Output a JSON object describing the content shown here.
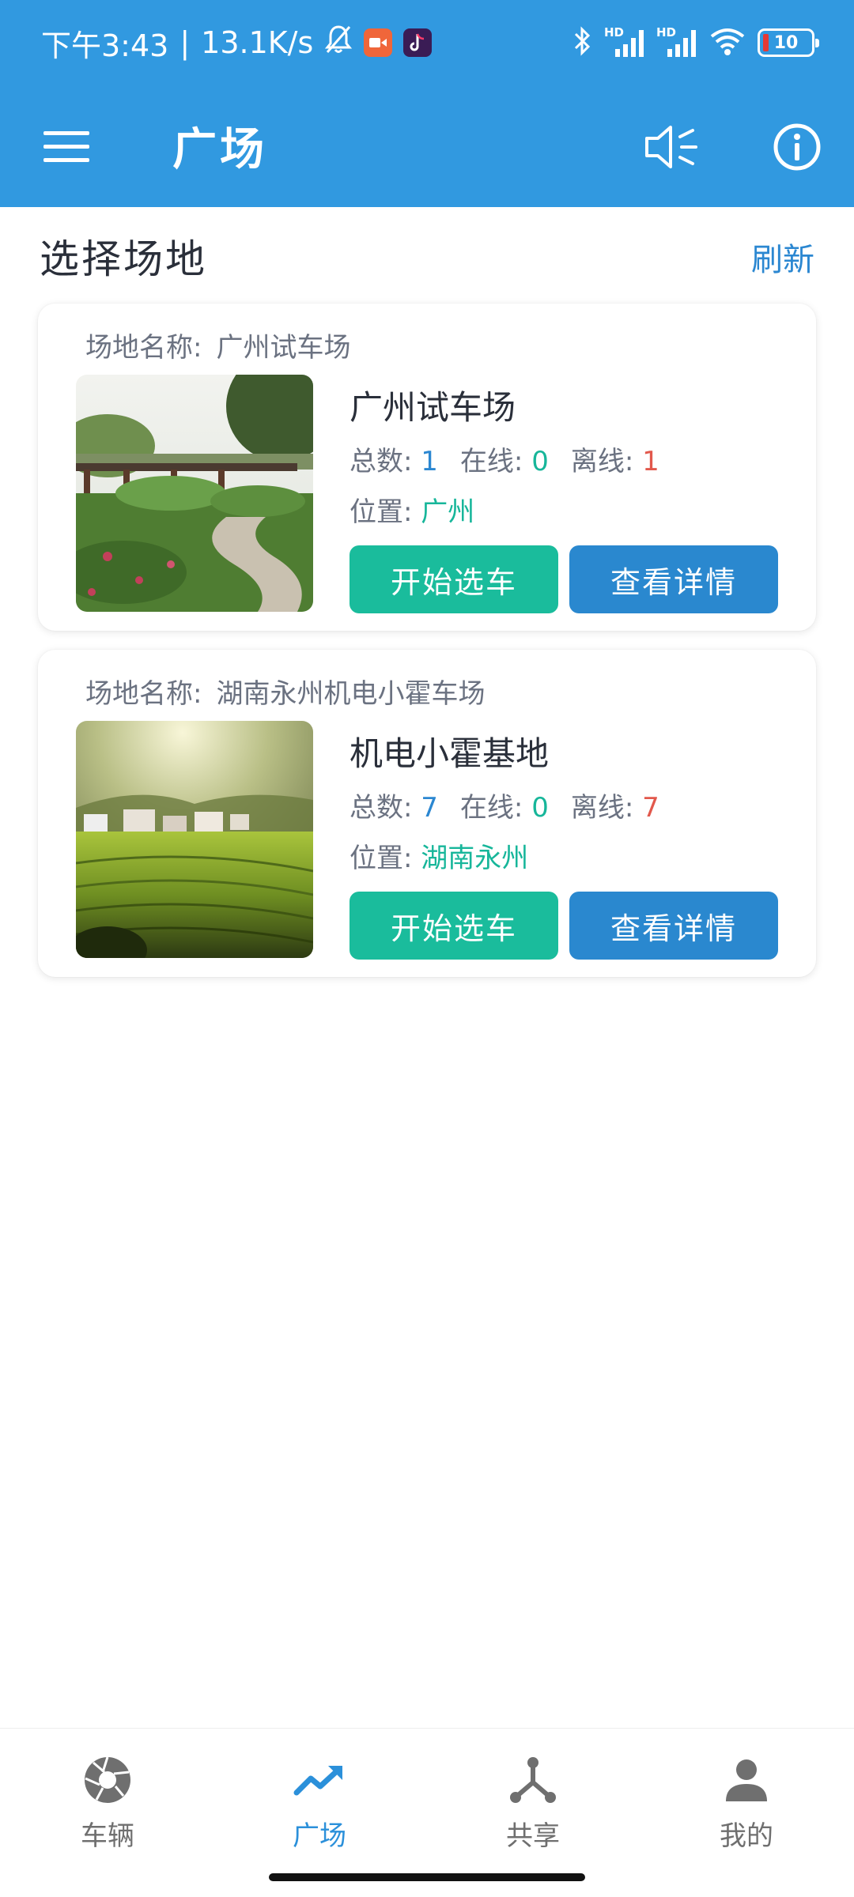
{
  "status_bar": {
    "time": "下午3:43",
    "separator": "|",
    "net_speed": "13.1K/s",
    "battery": "10",
    "hd_label": "HD",
    "icons": [
      "mute-bell-icon",
      "video-app-icon",
      "tiktok-app-icon",
      "bluetooth-icon",
      "signal-icon",
      "signal-icon",
      "wifi-icon",
      "battery-icon"
    ]
  },
  "app_bar": {
    "title": "广场",
    "icons": [
      "menu-icon",
      "speaker-icon",
      "info-icon"
    ]
  },
  "section": {
    "title": "选择场地",
    "refresh_label": "刷新"
  },
  "colors": {
    "primary": "#3199e0",
    "accent_green": "#1abc9c",
    "accent_blue": "#2a88cf",
    "offline_red": "#e2584c"
  },
  "venues": [
    {
      "label_prefix": "场地名称:",
      "label_value": "广州试车场",
      "name": "广州试车场",
      "total_label": "总数:",
      "total": "1",
      "online_label": "在线:",
      "online": "0",
      "offline_label": "离线:",
      "offline": "1",
      "location_label": "位置:",
      "location": "广州",
      "select_label": "开始选车",
      "detail_label": "查看详情"
    },
    {
      "label_prefix": "场地名称:",
      "label_value": "湖南永州机电小霍车场",
      "name": "机电小霍基地",
      "total_label": "总数:",
      "total": "7",
      "online_label": "在线:",
      "online": "0",
      "offline_label": "离线:",
      "offline": "7",
      "location_label": "位置:",
      "location": "湖南永州",
      "select_label": "开始选车",
      "detail_label": "查看详情"
    }
  ],
  "bottom_nav": {
    "items": [
      {
        "label": "车辆",
        "icon": "aperture-icon",
        "active": false
      },
      {
        "label": "广场",
        "icon": "trending-up-icon",
        "active": true
      },
      {
        "label": "共享",
        "icon": "share-network-icon",
        "active": false
      },
      {
        "label": "我的",
        "icon": "person-icon",
        "active": false
      }
    ]
  }
}
